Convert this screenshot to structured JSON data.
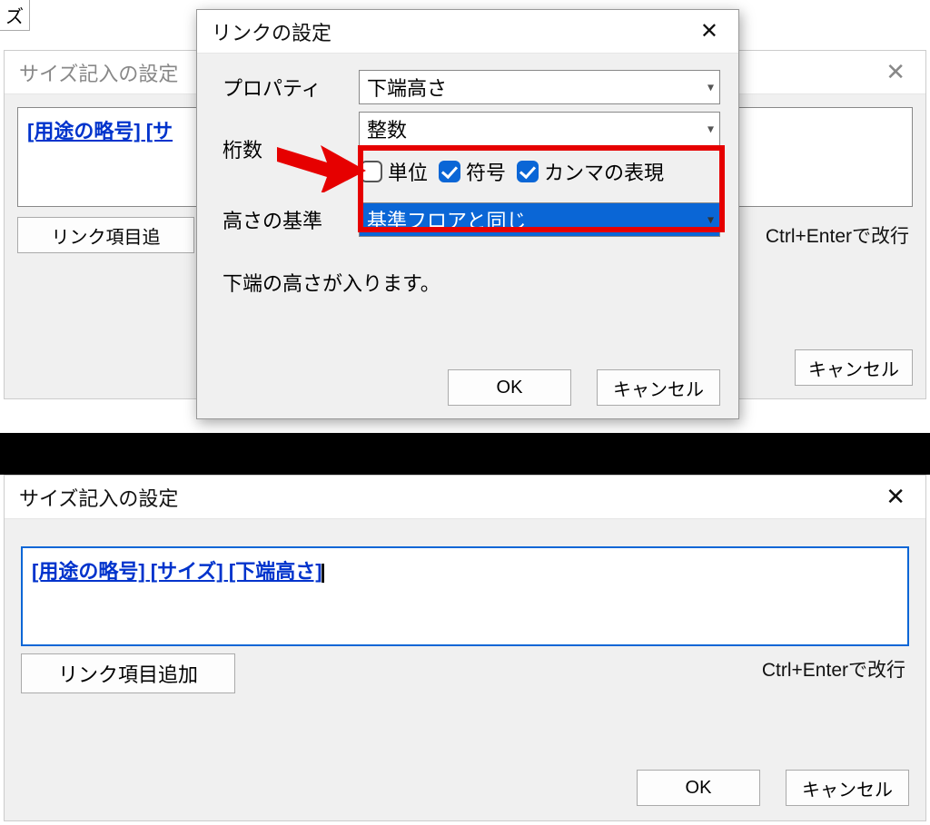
{
  "corner": "ズ",
  "backDialog": {
    "title": "サイズ記入の設定",
    "linkText": "[用途の略号] [サ",
    "addLinkBtn": "リンク項目追",
    "hint": "Ctrl+Enterで改行",
    "cancel": "キャンセル"
  },
  "frontDialog": {
    "title": "リンクの設定",
    "labels": {
      "property": "プロパティ",
      "digits": "桁数",
      "heightRef": "高さの基準"
    },
    "propertyValue": "下端高さ",
    "digitsValue": "整数",
    "heightRefValue": "基準フロアと同じ",
    "checkboxes": {
      "unit": "単位",
      "sign": "符号",
      "comma": "カンマの表現"
    },
    "desc": "下端の高さが入ります。",
    "ok": "OK",
    "cancel": "キャンセル"
  },
  "bottomDialog": {
    "title": "サイズ記入の設定",
    "linkText": "[用途の略号] [サイズ] [下端高さ]",
    "addLinkBtn": "リンク項目追加",
    "hint": "Ctrl+Enterで改行",
    "ok": "OK",
    "cancel": "キャンセル"
  }
}
